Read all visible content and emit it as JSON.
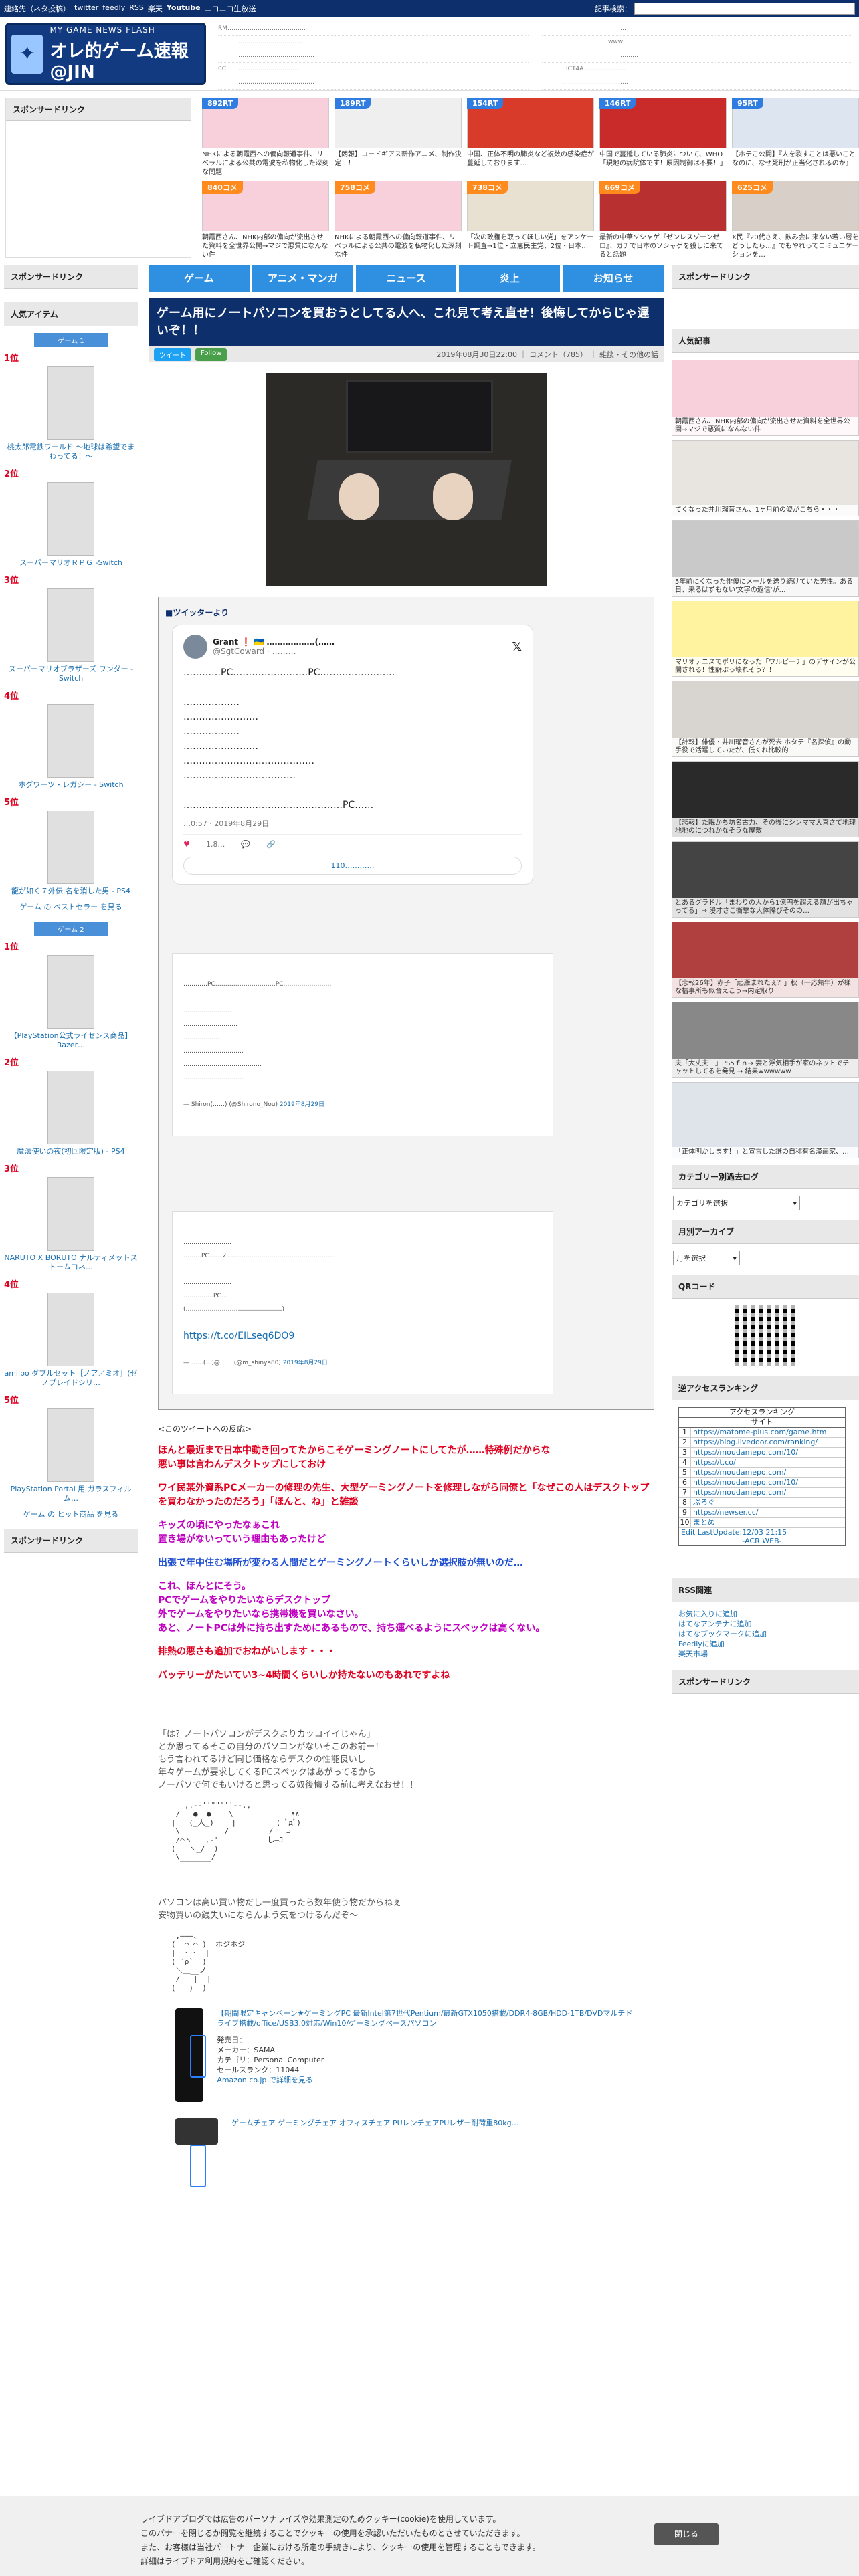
{
  "topbar": {
    "links": [
      "連絡先（ネタ投稿）",
      "twitter",
      "feedly",
      "RSS",
      "楽天",
      "Youtube",
      "ニコニコ生放送"
    ],
    "search_label": "記事検索："
  },
  "header": {
    "logo_small": "MY GAME NEWS FLASH",
    "logo_big": "オレ的ゲーム速報@JIN",
    "list1": [
      "RM…………………………………",
      "……………………………………",
      "…………………………………………",
      "0C………………………………",
      "…………………………………………"
    ],
    "list2": [
      "……………………………………",
      "……………………………www",
      "…………………………………………",
      "…………ICT4A…………………",
      "……… ……………………………"
    ]
  },
  "ads": {
    "label": "スポンサードリンク",
    "thumbs": [
      {
        "badge": "892RT",
        "cap": "NHKによる朝霞西への偏向報道事件、リベラルによる公共の電波を私物化した深刻な問題"
      },
      {
        "badge": "189RT",
        "cap": "【朗報】コードギアス新作アニメ、制作決定！！"
      },
      {
        "badge": "154RT",
        "cap": "中国、正体不明の肺炎など複数の感染症が蔓延しております…"
      },
      {
        "badge": "146RT",
        "cap": "中国で蔓延している肺炎について、WHO「現地の病院体です！原因制御は不要！」"
      },
      {
        "badge": "95RT",
        "cap": "【ホテこ公開】『人を裂すことは悪いことなのに、なぜ死刑が正当化されるのか』"
      },
      {
        "badge": "840コメ",
        "cap": "朝霞西さん、NHK内部の偏向が流出させた資料を全世界公開→マジで悪質になんない件"
      },
      {
        "badge": "758コメ",
        "cap": "NHKによる朝霞西への偏向報道事件、リベラルによる公共の電波を私物化した深刻な件"
      },
      {
        "badge": "738コメ",
        "cap": "「次の政権を取ってほしい党」をアンケート調査→1位・立憲民主党、2位・日本…"
      },
      {
        "badge": "669コメ",
        "cap": "最新の中華ソシャゲ『ゼンレスゾーンゼロ』、ガチで日本のソシャゲを殺しに来てると話題"
      },
      {
        "badge": "625コメ",
        "cap": "X民『20代さえ、飲み会に来ない若い層をどうしたら…』でもやれってコミュニケーションを…"
      }
    ]
  },
  "left": {
    "sponsor": "スポンサードリンク",
    "popular_items": "人気アイテム",
    "game1": "ゲーム 1",
    "ranks1": [
      {
        "no": "1位",
        "title": "桃太郎電鉄ワールド ～地球は希望でまわってる！～"
      },
      {
        "no": "2位",
        "title": "スーパーマリオＲＰＧ -Switch"
      },
      {
        "no": "3位",
        "title": "スーパーマリオブラザーズ ワンダー -Switch"
      },
      {
        "no": "4位",
        "title": "ホグワーツ・レガシー - Switch"
      },
      {
        "no": "5位",
        "title": "龍が如く７外伝 名を消した男 - PS4"
      }
    ],
    "best1": "ゲーム の ベストセラー を見る",
    "game2": "ゲーム 2",
    "ranks2": [
      {
        "no": "1位",
        "title": "【PlayStation公式ライセンス商品】Razer…"
      },
      {
        "no": "2位",
        "title": "魔法使いの夜(初回限定版) - PS4"
      },
      {
        "no": "3位",
        "title": "NARUTO X BORUTO ナルティメットストームコネ…"
      },
      {
        "no": "4位",
        "title": "amiibo ダブルセット［ノア／ミオ］(ゼノブレイドシリ…"
      },
      {
        "no": "5位",
        "title": "PlayStation Portal 用 ガラスフィルム…"
      }
    ],
    "best2": "ゲーム の ヒット商品 を見る",
    "sponsor2": "スポンサードリンク"
  },
  "nav": {
    "tabs": [
      "ゲーム",
      "アニメ・マンガ",
      "ニュース",
      "炎上",
      "お知らせ"
    ]
  },
  "article": {
    "title": "ゲーム用にノートパソコンを買おうとしてる人へ、これ見て考え直せ！後悔してからじゃ遅いぞ！！",
    "tweet_btn": "ツイート",
    "follow_btn": "Follow",
    "meta": "2019年08月30日22:00 ｜ コメント（785） ｜ 雑談・その他の話",
    "twitter_from": "■ツイッターより",
    "tweet1": {
      "name": "Grant ❗ 🇺🇦 ………………(……",
      "handle": "@SgtCoward · ………",
      "text": "…………PC……………………PC……………………\n\n………………\n……………………\n………………\n……………………\n……………………………………\n………………………………\n\n……………………………………………PC……",
      "date": "…0:57 · 2019年8月29日",
      "likes": "1.8…",
      "more": "110…………"
    },
    "quote1": {
      "text": "…………PC…………………………PC……………………\n\n……………………\n………………………\n………………\n…………………………\n…………………………………\n…………………………",
      "by": "— Shiron(……) (@Shirono_Nou)",
      "date": "2019年8月29日"
    },
    "quote2": {
      "text": "……………………\n………PC……２………………………………………………\n\n……………………\n……………PC…\n(…………………………………………)",
      "link": "https://t.co/EILseq6DO9",
      "by": "— ……(…)@…… (@m_shinya80)",
      "date": "2019年8月29日"
    },
    "reactions_head": "<このツイートへの反応>",
    "reactions": [
      {
        "cls": "red",
        "text": "ほんと最近まで日本中動き回ってたからこそゲーミングノートにしてたが……特殊例だからな\n悪い事は言わんデスクトップにしておけ"
      },
      {
        "cls": "red",
        "text": "ワイ民某外資系PCメーカーの修理の先生、大型ゲーミングノートを修理しながら同僚と「なぜこの人はデスクトップを買わなかったのだろう」「ほんと、ね」と雑談"
      },
      {
        "cls": "purple",
        "text": "キッズの頃にやったなぁこれ\n置き場がないっていう理由もあったけど"
      },
      {
        "cls": "blue",
        "text": "出張で年中住む場所が変わる人間だとゲーミングノートくらいしか選択肢が無いのだ…"
      },
      {
        "cls": "purple",
        "text": "これ、ほんとにそう。\nPCでゲームをやりたいならデスクトップ\n外でゲームをやりたいなら携帯機を買いなさい。\nあと、ノートPCは外に持ち出すためにあるもので、持ち運べるようにスペックは高くない。"
      },
      {
        "cls": "red",
        "text": "排熱の悪さも追加でおねがいします・・・"
      },
      {
        "cls": "red",
        "text": "バッテリーがたいてい3~4時間くらいしか持たないのもあれですよね"
      }
    ],
    "aa1": "「は？ノートパソコンがデスクよりカッコイイじゃん」\nとか思ってるそこの自分のパソコンがないそこのお前ー！\nもう言われてるけど同じ価格ならデスクの性能良いし\n年々ゲームが要求してくるPCスペックはあがってるから\nノーパソで何でもいけると思ってる奴後悔する前に考えなおせ！！",
    "aa2": "パソコンは高い買い物だし一度買ったら数年使う物だからねぇ\n安物買いの銭失いにならんよう気をつけるんだぞ～",
    "product": {
      "link": "【期間限定キャンペーン★ゲーミングPC 最新Intel第7世代Pentium/最新GTX1050搭載/DDR4-8GB/HDD-1TB/DVDマルチドライブ搭載/office/USB3.0対応/Win10/ゲーミングベースパソコン",
      "release": "発売日：",
      "maker": "メーカー：SAMA",
      "category": "カテゴリ：Personal Computer",
      "rank": "セールスランク：11044",
      "amazon": "Amazon.co.jp で詳細を見る"
    },
    "product2": "ゲームチェア ゲーミングチェア オフィスチェア PUレンチェアPUレザー耐荷重80kg…"
  },
  "right": {
    "sponsor": "スポンサードリンク",
    "popular": "人気記事",
    "pops": [
      "朝霞西さん、NHK内部の偏向が流出させた資料を全世界公開→マジで悪質になんない件",
      "てくなった井川瑠音さん、1ヶ月前の姿がこちら・・・",
      "5年前にくなった俳優にメールを送り続けていた男性。ある日、来るはずもない'文字の返信'が…",
      "マリオテニスでポリになった「ワルピーチ」のデザインが公開される！性癖ぶっ壊れそう？！",
      "【計報】俳優・井川瑠音さんが死去 ホタテ『名探偵』の動手役で活躍していたが、低くれ比較的",
      "【悲報】た眠かち坊名古力、その後にシンママ大喜さて地理地地のにつれかなそうな屋敷",
      "とあるグラドル「まわりの人から1億円を超える額が出ちゃってる」→ 漫才さこ衝撃な大体降びそのの…",
      "【悲報26年】赤子「起雁まれたぇ？」秋（一応熟年）が様な枯事所も似合えこう→内定取り",
      "夫「大丈夫！」PS5ｆｎ→ 妻と浮気相手が家のネットでチャットしてるを発見 → 結果wwwwww",
      "「正体明かします！」と宣言した謎の自称有名漢画家、…"
    ],
    "cat_head": "カテゴリー別過去ログ",
    "cat_select": "カテゴリを選択",
    "month_head": "月別アーカイブ",
    "month_select": "月を選択",
    "qr_head": "QRコード",
    "rank_head": "逆アクセスランキング",
    "acc_title": "アクセスランキング",
    "acc_sub": "サイト",
    "acc_rows": [
      "https://matome-plus.com/game.htm",
      "https://blog.livedoor.com/ranking/",
      "https://moudamepo.com/10/",
      "https://t.co/",
      "https://moudamepo.com/",
      "https://moudamepo.com/10/",
      "https://moudamepo.com/",
      "ぶろぐ",
      "https://newser.cc/",
      "まとめ"
    ],
    "acc_update": "Edit LastUpdate:12/03 21:15",
    "acc_footer": "-ACR WEB-",
    "rss_head": "RSS関連",
    "rss": [
      "お気に入りに追加",
      "はてなアンテナに追加",
      "はてなブックマークに追加",
      "Feedlyに追加",
      "楽天市場"
    ],
    "sponsor2": "スポンサードリンク"
  },
  "cookie": {
    "text": "ライブドアブログでは広告のパーソナライズや効果測定のためクッキー(cookie)を使用しています。\nこのバナーを閉じるか閲覧を継続することでクッキーの使用を承認いただいたものとさせていただきます。\nまた、お客様は当社パートナー企業における所定の手続きにより、クッキーの使用を管理することもできます。\n詳細はライブドア利用規約をご確認ください。",
    "button": "閉じる"
  }
}
